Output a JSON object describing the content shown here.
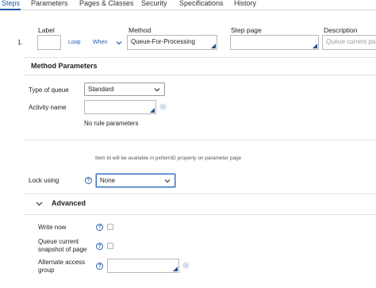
{
  "tabs": [
    {
      "label": "Steps"
    },
    {
      "label": "Parameters"
    },
    {
      "label": "Pages & Classes"
    },
    {
      "label": "Security"
    },
    {
      "label": "Specifications"
    },
    {
      "label": "History"
    }
  ],
  "columns": {
    "label": "Label",
    "method": "Method",
    "step_page": "Step page",
    "description": "Description"
  },
  "step": {
    "number": "1.",
    "label_value": "",
    "loop_link": "Loop",
    "when_link": "When",
    "method_value": "Queue-For-Processing",
    "step_page_value": "",
    "description_placeholder": "Queue current pa"
  },
  "method_parameters": {
    "title": "Method Parameters",
    "type_of_queue_label": "Type of queue",
    "type_of_queue_value": "Standard",
    "activity_name_label": "Activity name",
    "activity_name_value": "",
    "no_rule_parameters": "No rule parameters",
    "item_id_note": "Item Id will be available in pxItemID property on parameter page",
    "lock_using_label": "Lock using",
    "lock_using_value": "None"
  },
  "advanced": {
    "title": "Advanced",
    "write_now_label": "Write now",
    "queue_snapshot_label_line1": "Queue current",
    "queue_snapshot_label_line2": "snapshot of page",
    "alternate_access_group_label_line1": "Alternate access",
    "alternate_access_group_label_line2": "group",
    "alternate_access_group_value": ""
  },
  "icons": {
    "help": "?",
    "help_icon": "question-circle-icon",
    "gear_icon": "gear-icon",
    "chevron_icon": "chevron-down-icon",
    "collapse_icon": "chevron-up-icon"
  },
  "colors": {
    "accent": "#1f5aa6",
    "focus_border": "#3a6fb7"
  }
}
